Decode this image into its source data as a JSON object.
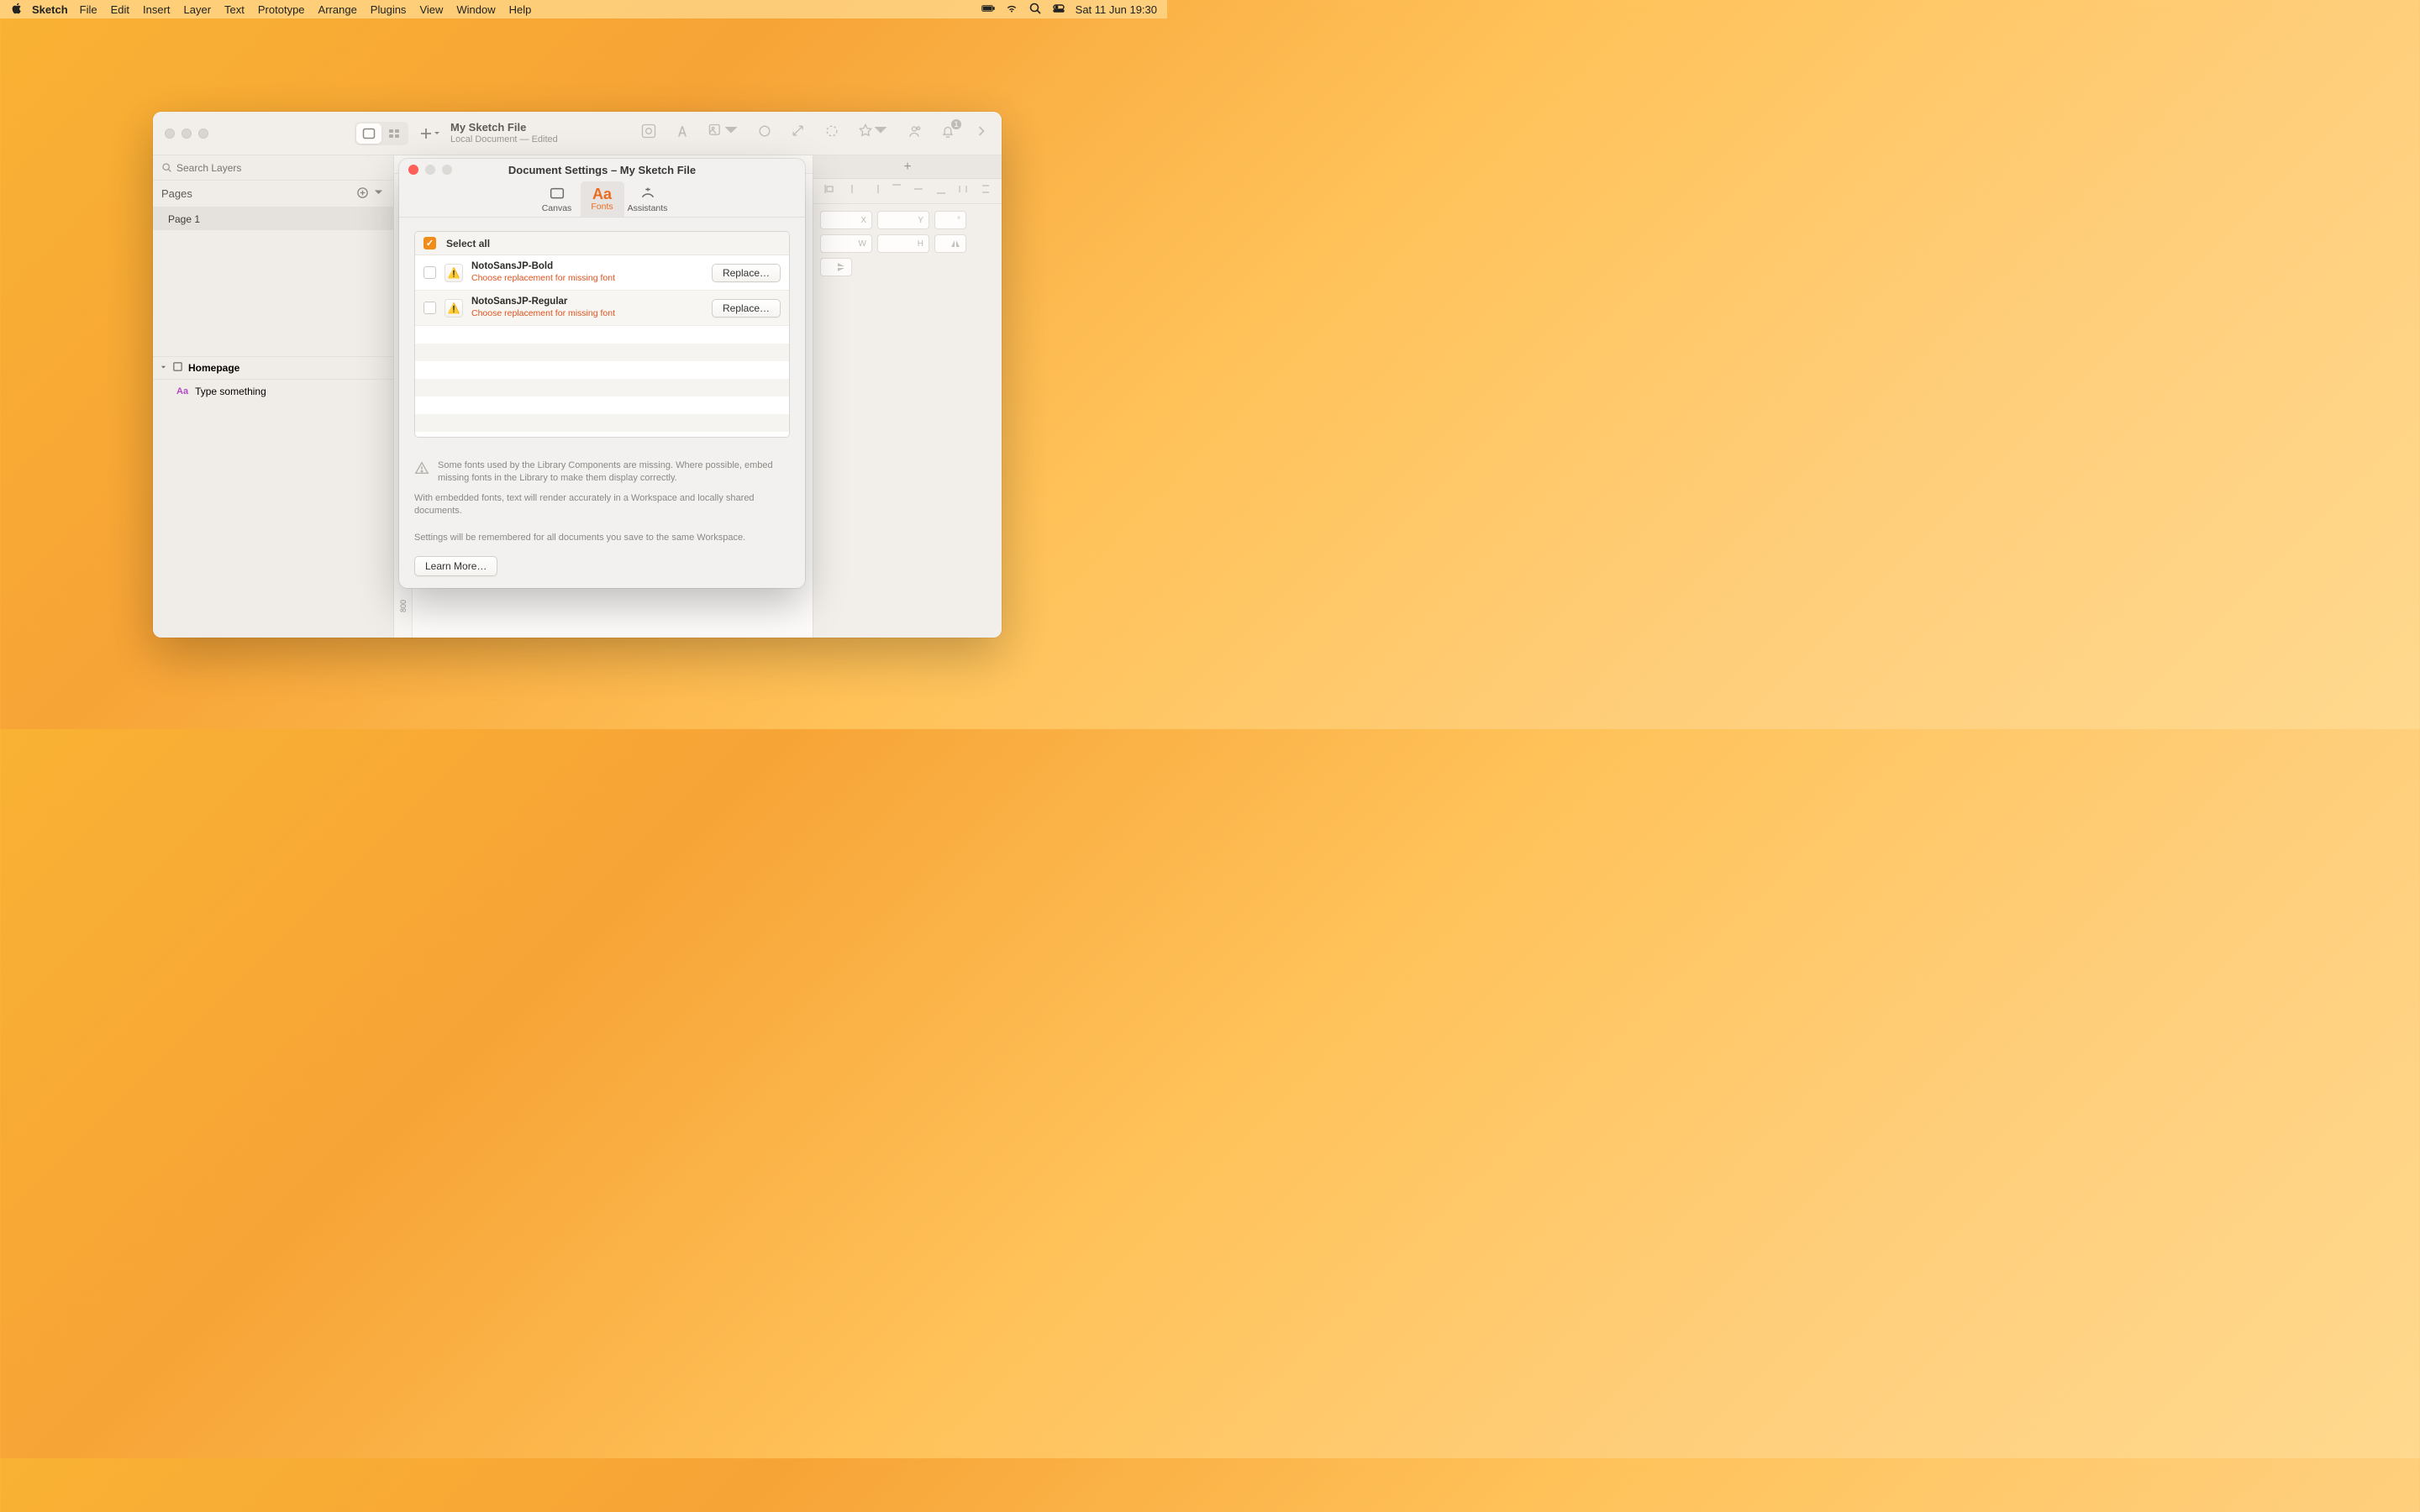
{
  "menubar": {
    "app": "Sketch",
    "items": [
      "File",
      "Edit",
      "Insert",
      "Layer",
      "Text",
      "Prototype",
      "Arrange",
      "Plugins",
      "View",
      "Window",
      "Help"
    ],
    "clock": "Sat 11 Jun  19:30"
  },
  "window": {
    "title": "My Sketch File",
    "subtitle": "Local Document — Edited",
    "notification_count": "1"
  },
  "sidebar": {
    "search_placeholder": "Search Layers",
    "pages_label": "Pages",
    "page": "Page 1",
    "group": "Homepage",
    "text_layer": "Type something"
  },
  "ruler": {
    "mark": "800"
  },
  "inspector": {
    "fields": [
      "X",
      "Y",
      "°",
      "W",
      "H"
    ]
  },
  "modal": {
    "title": "Document Settings – My Sketch File",
    "tabs": {
      "canvas": "Canvas",
      "fonts": "Fonts",
      "assistants": "Assistants"
    },
    "select_all": "Select all",
    "fonts": [
      {
        "name": "NotoSansJP-Bold",
        "sub": "Choose replacement for missing font",
        "btn": "Replace…"
      },
      {
        "name": "NotoSansJP-Regular",
        "sub": "Choose replacement for missing font",
        "btn": "Replace…"
      }
    ],
    "note1": "Some fonts used by the Library Components are missing. Where possible, embed missing fonts in the Library to make them display correctly.",
    "note2": "With embedded fonts, text will render accurately in a Workspace and locally shared documents.",
    "note3": "Settings will be remembered for all documents you save to the same Workspace.",
    "learn": "Learn More…"
  }
}
